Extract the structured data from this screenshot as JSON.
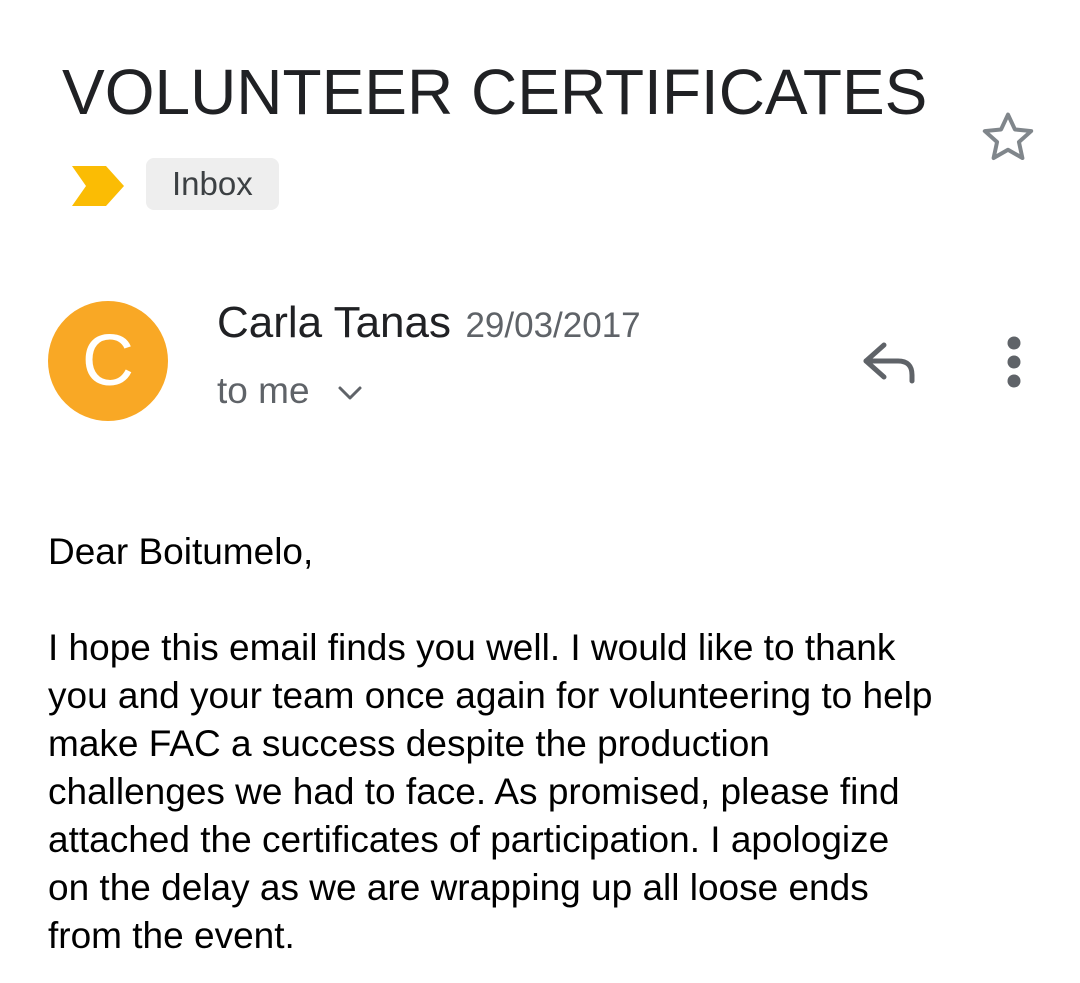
{
  "email": {
    "subject": "VOLUNTEER CERTIFICATES",
    "label": "Inbox",
    "sender": {
      "name": "Carla Tanas",
      "initial": "C",
      "avatar_color": "#f9a825"
    },
    "date": "29/03/2017",
    "recipient": "to me",
    "greeting": "Dear Boitumelo,",
    "body": "I hope this email finds you well.  I would like to thank\nyou and your team once again for volunteering to help\nmake FAC a success despite the production\nchallenges we had to face.  As promised, please find\nattached the certificates of participation.  I apologize\non the delay as we are wrapping up all loose ends\nfrom the event."
  },
  "icons": {
    "star": "star-outline-icon",
    "importance": "importance-marker-icon",
    "reply": "reply-icon",
    "more": "more-vert-icon",
    "chevron": "chevron-down-icon"
  },
  "colors": {
    "importance_marker": "#fbbc04",
    "label_chip_bg": "#eeeeee",
    "secondary_text": "#5f6368"
  }
}
